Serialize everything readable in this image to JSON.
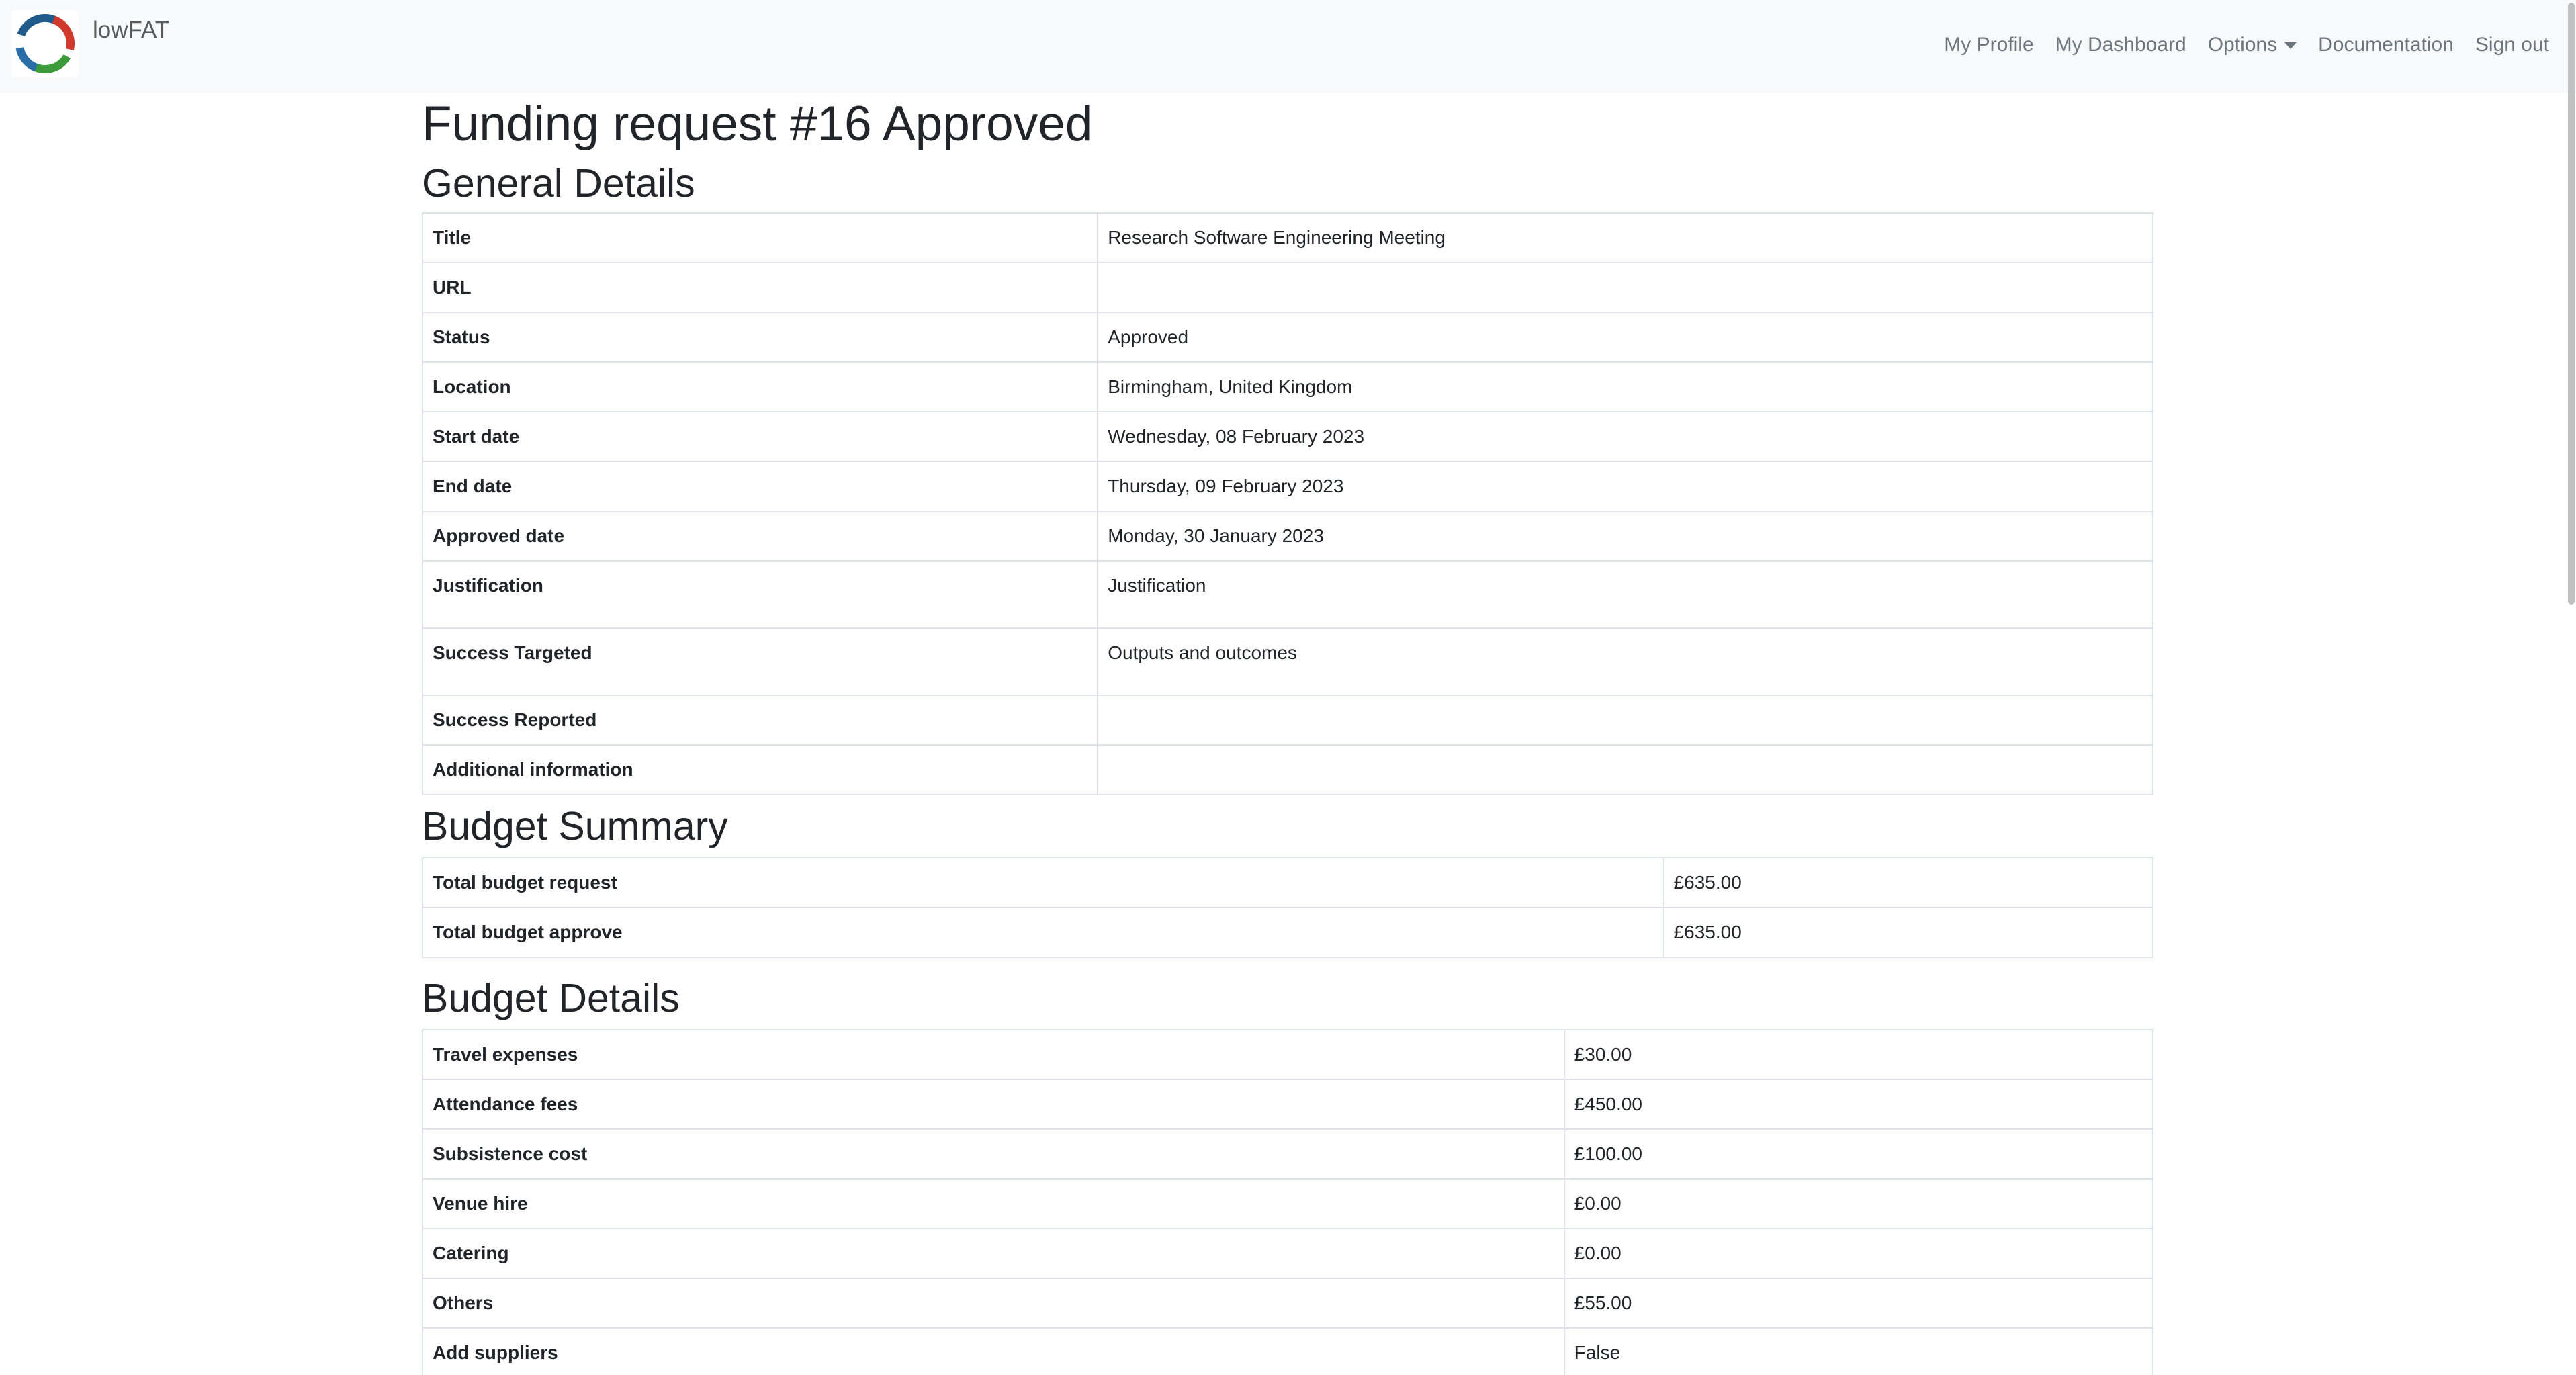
{
  "navbar": {
    "brand": "lowFAT",
    "links": {
      "profile": "My Profile",
      "dashboard": "My Dashboard",
      "options": "Options",
      "documentation": "Documentation",
      "signout": "Sign out"
    }
  },
  "page": {
    "title": "Funding request #16 Approved"
  },
  "general": {
    "heading": "General Details",
    "rows": [
      {
        "label": "Title",
        "value": "Research Software Engineering Meeting"
      },
      {
        "label": "URL",
        "value": ""
      },
      {
        "label": "Status",
        "value": "Approved"
      },
      {
        "label": "Location",
        "value": "Birmingham, United Kingdom"
      },
      {
        "label": "Start date",
        "value": "Wednesday, 08 February 2023"
      },
      {
        "label": "End date",
        "value": "Thursday, 09 February 2023"
      },
      {
        "label": "Approved date",
        "value": "Monday, 30 January 2023"
      },
      {
        "label": "Justification",
        "value": "Justification"
      },
      {
        "label": "Success Targeted",
        "value": "Outputs and outcomes"
      },
      {
        "label": "Success Reported",
        "value": ""
      },
      {
        "label": "Additional information",
        "value": ""
      }
    ]
  },
  "summary": {
    "heading": "Budget Summary",
    "rows": [
      {
        "label_bold": "Total",
        "label_rest": " budget request",
        "value": "£635.00"
      },
      {
        "label_bold": "Total",
        "label_rest": " budget approve",
        "value": "£635.00"
      }
    ]
  },
  "details": {
    "heading": "Budget Details",
    "rows": [
      {
        "label": "Travel expenses",
        "value": "£30.00"
      },
      {
        "label": "Attendance fees",
        "value": "£450.00"
      },
      {
        "label": "Subsistence cost",
        "value": "£100.00"
      },
      {
        "label": "Venue hire",
        "value": "£0.00"
      },
      {
        "label": "Catering",
        "value": "£0.00"
      },
      {
        "label": "Others",
        "value": "£55.00"
      },
      {
        "label": "Add suppliers",
        "value": "False"
      }
    ]
  },
  "colors": {
    "navbar_bg": "#f8f9fa",
    "nav_text": "#6c757d",
    "table_border": "#dee2e6",
    "text": "#212529"
  },
  "icons": {
    "logo": "lowfat-logo"
  }
}
